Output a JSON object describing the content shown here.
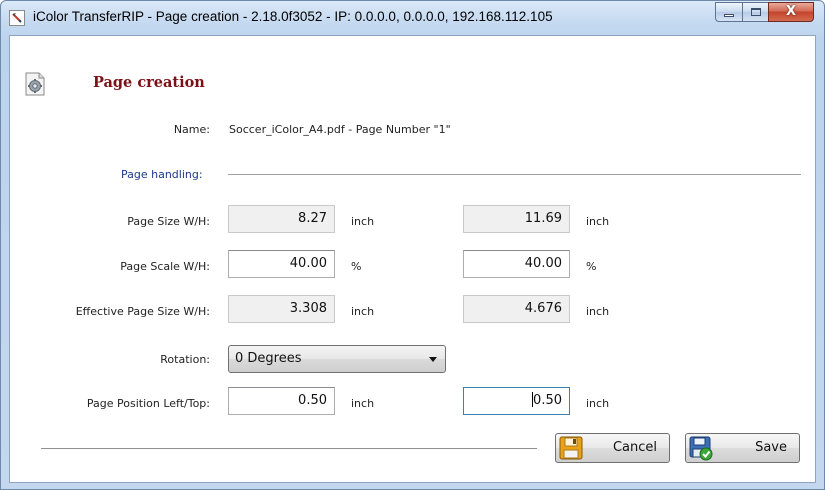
{
  "window": {
    "title": "iColor TransferRIP - Page creation - 2.18.0f3052 - IP: 0.0.0.0, 0.0.0.0, 192.168.112.105",
    "close_label": "X"
  },
  "header": {
    "title": "Page creation",
    "icon": "gear-page-icon"
  },
  "form": {
    "name_label": "Name:",
    "name_value": "Soccer_iColor_A4.pdf - Page Number \"1\"",
    "section_label": "Page handling:",
    "page_size": {
      "label": "Page Size W/H:",
      "width": "8.27",
      "width_unit": "inch",
      "height": "11.69",
      "height_unit": "inch"
    },
    "page_scale": {
      "label": "Page Scale W/H:",
      "width": "40.00",
      "width_unit": "%",
      "height": "40.00",
      "height_unit": "%"
    },
    "effective_size": {
      "label": "Effective Page Size W/H:",
      "width": "3.308",
      "width_unit": "inch",
      "height": "4.676",
      "height_unit": "inch"
    },
    "rotation": {
      "label": "Rotation:",
      "selected": "0 Degrees"
    },
    "position": {
      "label": "Page Position Left/Top:",
      "left": "0.50",
      "left_unit": "inch",
      "top_before_caret": "",
      "top_after_caret": "0.50",
      "top_unit": "inch"
    }
  },
  "buttons": {
    "cancel": "Cancel",
    "save": "Save",
    "cancel_icon": "floppy-disk-icon",
    "save_icon": "save-check-icon"
  },
  "colors": {
    "title_accent": "#7a1116",
    "section_label": "#1d3a8a",
    "focus_border": "#3c7fb1"
  }
}
